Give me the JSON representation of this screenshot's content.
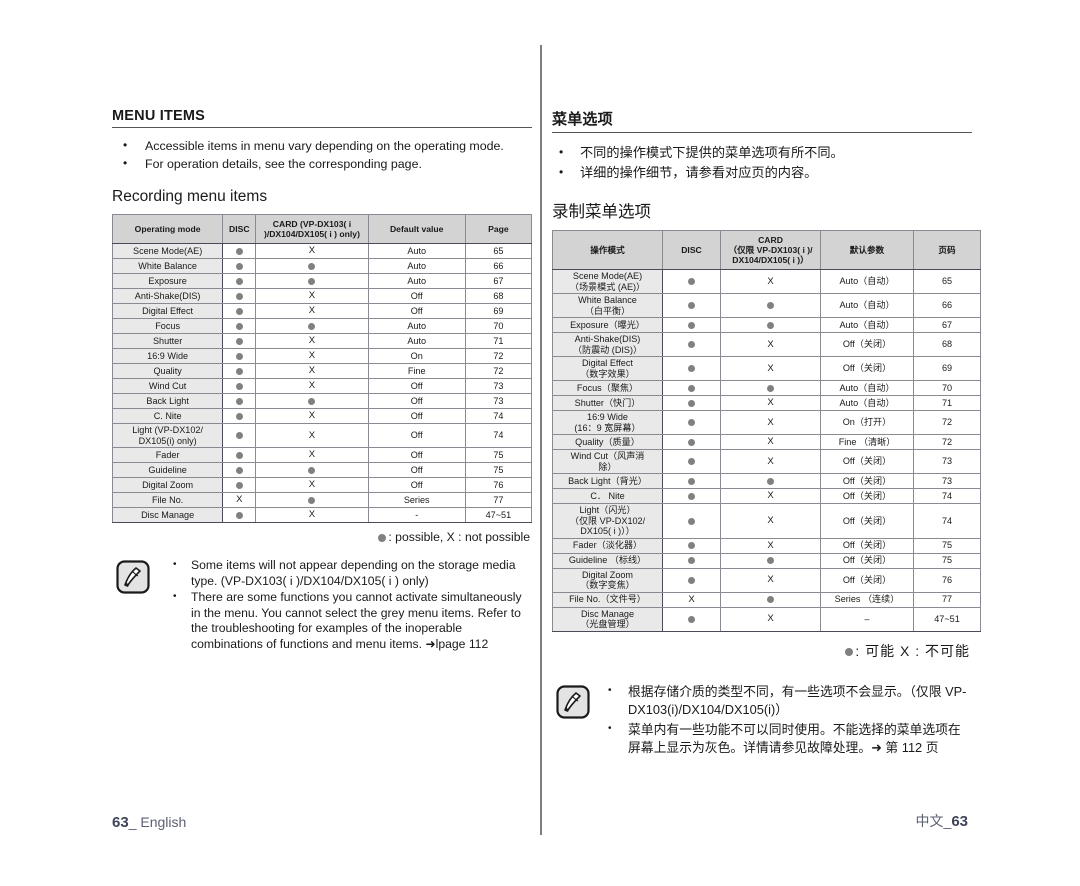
{
  "left": {
    "section_title": "MENU ITEMS",
    "intro_bullets": [
      "Accessible items in menu vary depending on the operating mode.",
      "For operation details, see the corresponding page."
    ],
    "sub_title": "Recording menu items",
    "table": {
      "headers": [
        "Operating mode",
        "DISC",
        "CARD (VP-DX103( i )/DX104/DX105( i ) only)",
        "Default value",
        "Page"
      ],
      "rows": [
        {
          "name": "Scene Mode(AE)",
          "disc": "dot",
          "card": "X",
          "default": "Auto",
          "page": "65"
        },
        {
          "name": "White Balance",
          "disc": "dot",
          "card": "dot",
          "default": "Auto",
          "page": "66"
        },
        {
          "name": "Exposure",
          "disc": "dot",
          "card": "dot",
          "default": "Auto",
          "page": "67"
        },
        {
          "name": "Anti-Shake(DIS)",
          "disc": "dot",
          "card": "X",
          "default": "Off",
          "page": "68"
        },
        {
          "name": "Digital Effect",
          "disc": "dot",
          "card": "X",
          "default": "Off",
          "page": "69"
        },
        {
          "name": "Focus",
          "disc": "dot",
          "card": "dot",
          "default": "Auto",
          "page": "70"
        },
        {
          "name": "Shutter",
          "disc": "dot",
          "card": "X",
          "default": "Auto",
          "page": "71"
        },
        {
          "name": "16:9 Wide",
          "disc": "dot",
          "card": "X",
          "default": "On",
          "page": "72"
        },
        {
          "name": "Quality",
          "disc": "dot",
          "card": "X",
          "default": "Fine",
          "page": "72"
        },
        {
          "name": "Wind Cut",
          "disc": "dot",
          "card": "X",
          "default": "Off",
          "page": "73"
        },
        {
          "name": "Back Light",
          "disc": "dot",
          "card": "dot",
          "default": "Off",
          "page": "73"
        },
        {
          "name": "C. Nite",
          "disc": "dot",
          "card": "X",
          "default": "Off",
          "page": "74"
        },
        {
          "name": "Light (VP-DX102/ DX105(i) only)",
          "disc": "dot",
          "card": "X",
          "default": "Off",
          "page": "74"
        },
        {
          "name": "Fader",
          "disc": "dot",
          "card": "X",
          "default": "Off",
          "page": "75"
        },
        {
          "name": "Guideline",
          "disc": "dot",
          "card": "dot",
          "default": "Off",
          "page": "75"
        },
        {
          "name": "Digital Zoom",
          "disc": "dot",
          "card": "X",
          "default": "Off",
          "page": "76"
        },
        {
          "name": "File No.",
          "disc": "X",
          "card": "dot",
          "default": "Series",
          "page": "77"
        },
        {
          "name": "Disc Manage",
          "disc": "dot",
          "card": "X",
          "default": "-",
          "page": "47~51"
        }
      ]
    },
    "legend": ": possible, X : not possible",
    "notes": [
      "Some items will not appear depending on the storage media type. (VP-DX103( i )/DX104/DX105( i ) only)",
      "There are some functions you cannot activate simultaneously in the menu. You cannot select the grey menu items. Refer to the troubleshooting for examples of the inoperable combinations of functions and menu items. ➜lpage 112"
    ],
    "footer_page": "63",
    "footer_label": "English"
  },
  "right": {
    "section_title": "菜单选项",
    "intro_bullets": [
      "不同的操作模式下提供的菜单选项有所不同。",
      "详细的操作细节，请参看对应页的内容。"
    ],
    "sub_title": "录制菜单选项",
    "table": {
      "headers": [
        "操作模式",
        "DISC",
        "CARD（仅限 VP-DX103( i )/DX104/DX105( i )）",
        "默认参数",
        "页码"
      ],
      "header_card_line1": "CARD",
      "header_card_line2": "（仅限 VP-DX103( i )/",
      "header_card_line3": "DX104/DX105( i )）",
      "rows": [
        {
          "name": "Scene Mode(AE)\n（场景模式 (AE)）",
          "disc": "dot",
          "card": "X",
          "default": "Auto（自动）",
          "page": "65"
        },
        {
          "name": "White Balance\n（白平衡）",
          "disc": "dot",
          "card": "dot",
          "default": "Auto（自动）",
          "page": "66"
        },
        {
          "name": "Exposure（曝光）",
          "disc": "dot",
          "card": "dot",
          "default": "Auto（自动）",
          "page": "67"
        },
        {
          "name": "Anti-Shake(DIS)\n（防震动 (DIS)）",
          "disc": "dot",
          "card": "X",
          "default": "Off（关闭）",
          "page": "68"
        },
        {
          "name": "Digital Effect\n（数字效果）",
          "disc": "dot",
          "card": "X",
          "default": "Off（关闭）",
          "page": "69"
        },
        {
          "name": "Focus（聚焦）",
          "disc": "dot",
          "card": "dot",
          "default": "Auto（自动）",
          "page": "70"
        },
        {
          "name": "Shutter（快门）",
          "disc": "dot",
          "card": "X",
          "default": "Auto（自动）",
          "page": "71"
        },
        {
          "name": "16:9 Wide\n(16：9 宽屏幕）",
          "disc": "dot",
          "card": "X",
          "default": "On（打开）",
          "page": "72"
        },
        {
          "name": "Quality（质量）",
          "disc": "dot",
          "card": "X",
          "default": "Fine （清晰）",
          "page": "72"
        },
        {
          "name": "Wind Cut（风声消\n除）",
          "disc": "dot",
          "card": "X",
          "default": "Off（关闭）",
          "page": "73"
        },
        {
          "name": "Back Light（背光）",
          "disc": "dot",
          "card": "dot",
          "default": "Off（关闭）",
          "page": "73"
        },
        {
          "name": "C． Nite",
          "disc": "dot",
          "card": "X",
          "default": "Off（关闭）",
          "page": "74"
        },
        {
          "name": "Light（闪光）\n（仅限 VP-DX102/\nDX105( i )））",
          "disc": "dot",
          "card": "X",
          "default": "Off（关闭）",
          "page": "74"
        },
        {
          "name": "Fader（淡化器）",
          "disc": "dot",
          "card": "X",
          "default": "Off（关闭）",
          "page": "75"
        },
        {
          "name": "Guideline （标线）",
          "disc": "dot",
          "card": "dot",
          "default": "Off（关闭）",
          "page": "75"
        },
        {
          "name": "Digital Zoom\n（数字变焦）",
          "disc": "dot",
          "card": "X",
          "default": "Off（关闭）",
          "page": "76"
        },
        {
          "name": "File No.（文件号）",
          "disc": "X",
          "card": "dot",
          "default": "Series （连续）",
          "page": "77"
        },
        {
          "name": "Disc Manage\n（光盘管理）",
          "disc": "dot",
          "card": "X",
          "default": "–",
          "page": "47~51"
        }
      ]
    },
    "legend": ": 可能  X : 不可能",
    "notes": [
      "根据存储介质的类型不同，有一些选项不会显示。（仅限 VP-DX103(i)/DX104/DX105(i)）",
      "菜单内有一些功能不可以同时使用。不能选择的菜单选项在屏幕上显示为灰色。详情请参见故障处理。➜ 第 112 页"
    ],
    "footer_page": "63",
    "footer_label": "中文"
  },
  "colors": {
    "header_bg": "#d3d3d3",
    "name_bg": "#e9e9e9",
    "dot": "#808080",
    "rule": "#4b4b57",
    "footer_text": "#5a5f72"
  }
}
